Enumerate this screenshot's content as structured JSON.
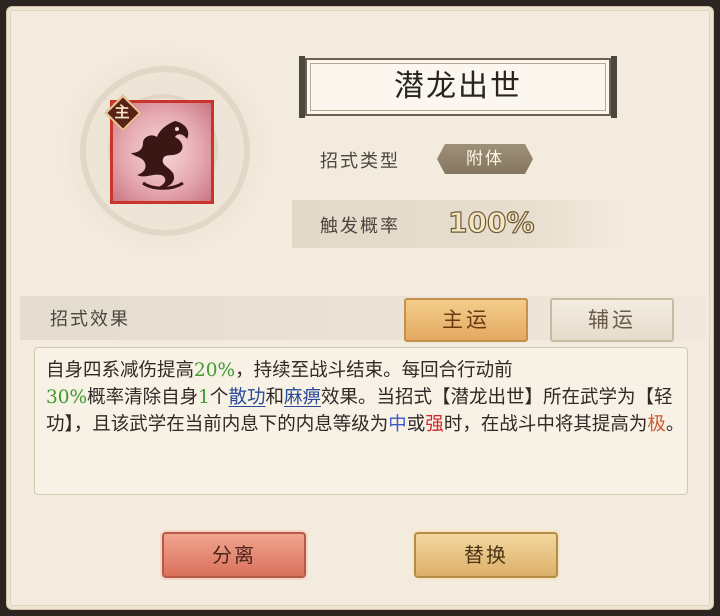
{
  "skill": {
    "name": "潜龙出世",
    "badge": "主",
    "type_label": "招式类型",
    "type_value": "附体",
    "rate_label": "触发概率",
    "rate_value": "100%"
  },
  "effect": {
    "label": "招式效果",
    "tabs": [
      "主运",
      "辅运"
    ],
    "active_tab": "主运",
    "description": {
      "p1": "自身四系减伤提高",
      "v1": "20%",
      "p2": "，持续至战斗结束。每回合行动前",
      "v2": "30%",
      "p3": "概率清除自身",
      "v3": "1",
      "p4": "个",
      "link1": "散功",
      "p5": "和",
      "link2": "麻痹",
      "p6": "效果。当招式【潜龙出世】所在武学为【轻功】，且该武学在当前内息下的内息等级为",
      "lvl1": "中",
      "p7": "或",
      "lvl2": "强",
      "p8": "时，在战斗中将其提高为",
      "lvl3": "极",
      "p9": "。"
    }
  },
  "buttons": {
    "split": "分离",
    "replace": "替换"
  },
  "colors": {
    "accent_tab": "#e4a962",
    "split_button": "#d9705c",
    "replace_button": "#dcb06a",
    "highlight_green": "#3f9a2f",
    "highlight_red": "#d02828"
  }
}
